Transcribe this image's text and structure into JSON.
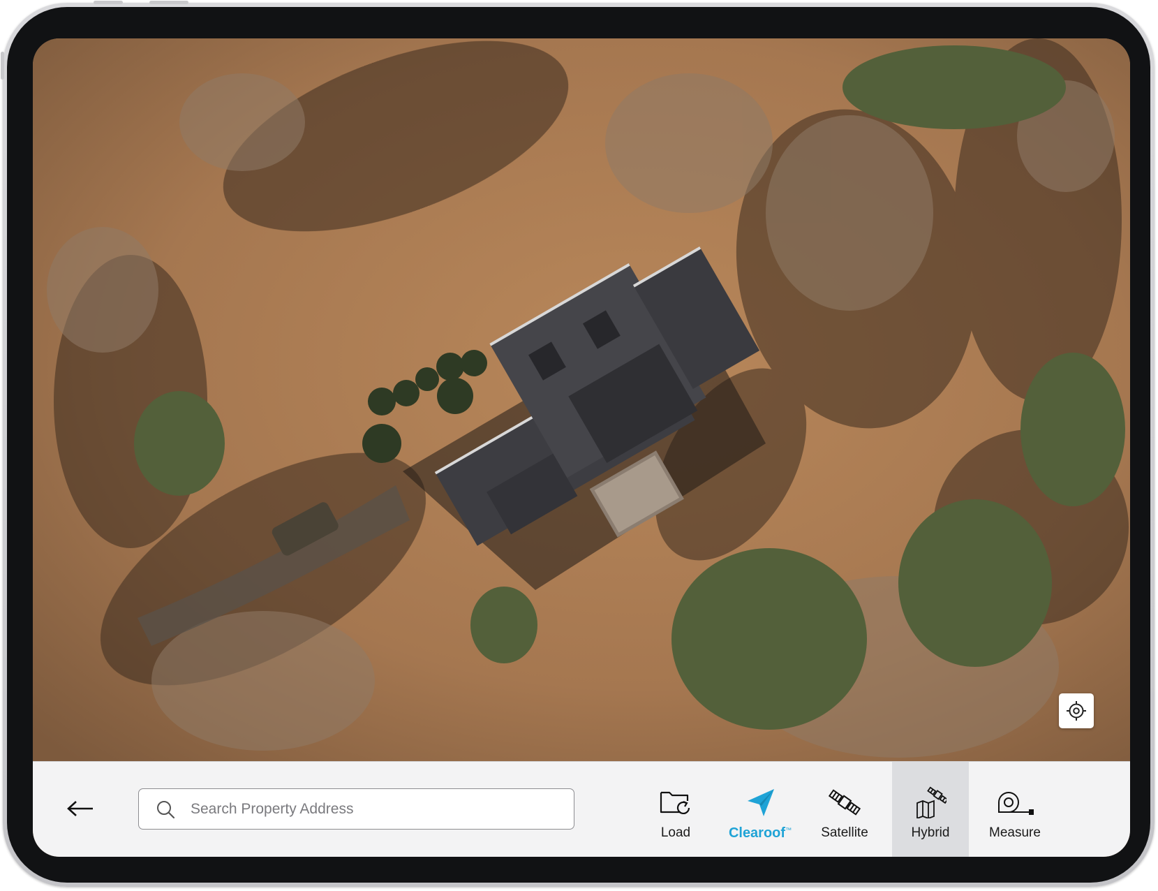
{
  "map": {
    "view_mode": "Hybrid",
    "locate_icon": "crosshair-locate-icon"
  },
  "toolbar": {
    "back_icon": "arrow-left-icon",
    "search": {
      "placeholder": "Search Property Address",
      "value": "",
      "icon": "search-icon"
    },
    "tools": [
      {
        "label": "Load",
        "icon": "folder-reload-icon",
        "active": false
      },
      {
        "label": "Clearoof",
        "trademark": "™",
        "icon": "paper-plane-icon",
        "active": false,
        "color": "#1fa3d6"
      },
      {
        "label": "Satellite",
        "icon": "satellite-icon",
        "active": false
      },
      {
        "label": "Hybrid",
        "icon": "hybrid-map-icon",
        "active": true
      },
      {
        "label": "Measure",
        "icon": "tape-measure-icon",
        "active": false
      }
    ]
  },
  "colors": {
    "brand": "#1fa3d6",
    "toolbar_bg": "#f3f3f4",
    "active_tool_bg": "#dcdde0"
  }
}
